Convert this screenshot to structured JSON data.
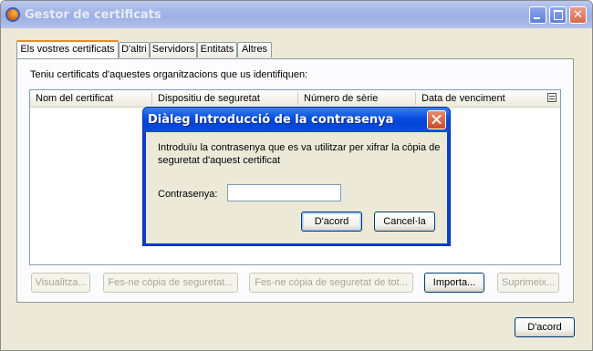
{
  "window": {
    "title": "Gestor de certificats",
    "controls": {
      "minimize": "",
      "maximize": "",
      "close": "✕"
    }
  },
  "tabs": [
    {
      "label": "Els vostres certificats",
      "active": true
    },
    {
      "label": "D'altri",
      "active": false
    },
    {
      "label": "Servidors",
      "active": false
    },
    {
      "label": "Entitats",
      "active": false
    },
    {
      "label": "Altres",
      "active": false
    }
  ],
  "panel": {
    "intro": "Teniu certificats d'aquestes organitzacions que us identifiquen:",
    "columns": [
      "Nom del certificat",
      "Dispositiu de seguretat",
      "Número de sèrie",
      "Data de venciment"
    ],
    "buttons": {
      "view": "Visualitza...",
      "backup": "Fes-ne còpia de seguretat...",
      "backup_all": "Fes-ne còpia de seguretat de tot...",
      "import": "Importa...",
      "delete": "Suprimeix..."
    }
  },
  "footer": {
    "ok": "D'acord"
  },
  "dialog": {
    "title": "Diàleg Introducció de la contrasenya",
    "message": "Introduïu la contrasenya que es va utilitzar per xifrar la còpia de seguretat d'aquest certificat",
    "password_label": "Contrasenya:",
    "password_value": "",
    "ok": "D'acord",
    "cancel": "Cancel·la"
  }
}
